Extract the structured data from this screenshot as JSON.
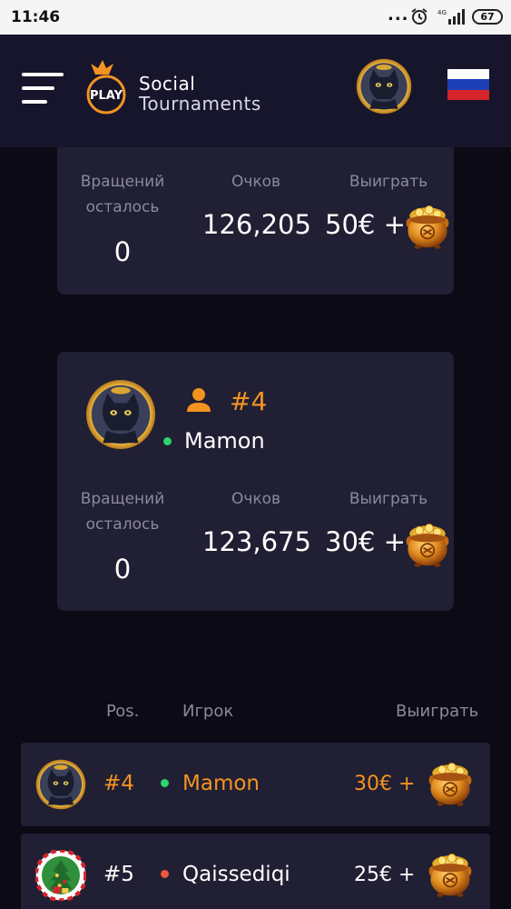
{
  "status_bar": {
    "time": "11:46",
    "dots": "...",
    "network": "4G",
    "battery": "67"
  },
  "header": {
    "brand_line1": "Social",
    "brand_line2": "Tournaments",
    "logo_text": "PLAY",
    "menu_icon": "hamburger-icon",
    "flag": "russia-flag"
  },
  "colors": {
    "accent": "#f39322",
    "online": "#2fd36b",
    "offline": "#f0553f",
    "card": "#201f33",
    "header": "#16152b",
    "background": "#0b0a15",
    "muted": "#8b8a9c"
  },
  "card_top": {
    "spins_label_line1": "Вращений",
    "spins_label_line2": "осталось",
    "spins_value": "0",
    "points_label": "Очков",
    "points_value": "126,205",
    "win_label": "Выиграть",
    "win_value": "50€ +"
  },
  "card_player": {
    "rank": "#4",
    "name": "Mamon",
    "status": "online",
    "spins_label_line1": "Вращений",
    "spins_label_line2": "осталось",
    "spins_value": "0",
    "points_label": "Очков",
    "points_value": "123,675",
    "win_label": "Выиграть",
    "win_value": "30€ +"
  },
  "leaderboard": {
    "headers": {
      "pos": "Pos.",
      "player": "Игрок",
      "win": "Выиграть"
    },
    "rows": [
      {
        "pos": "#4",
        "name": "Mamon",
        "win": "30€ +",
        "status": "online",
        "highlight": true,
        "avatar": "cat-avatar"
      },
      {
        "pos": "#5",
        "name": "Qaissediqi",
        "win": "25€ +",
        "status": "offline",
        "highlight": false,
        "avatar": "christmas-avatar"
      }
    ]
  }
}
